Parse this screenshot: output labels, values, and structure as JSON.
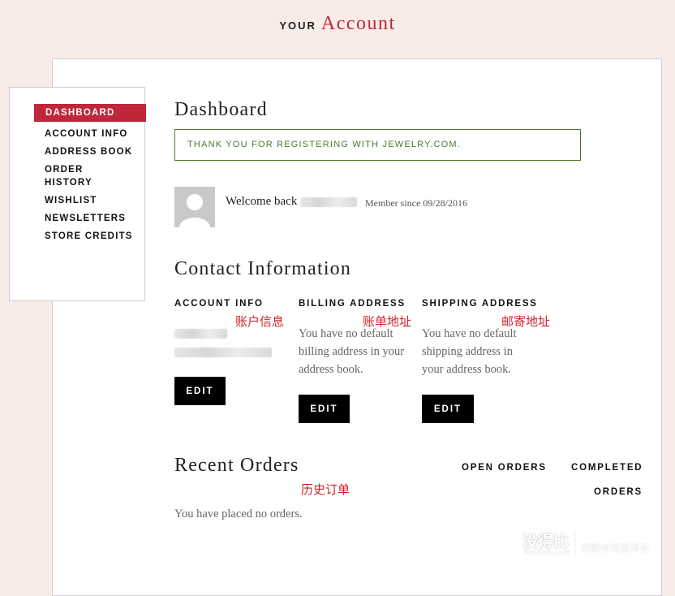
{
  "header": {
    "small": "your",
    "big": "Account"
  },
  "sidebar": {
    "items": [
      {
        "label": "DASHBOARD",
        "active": true
      },
      {
        "label": "ACCOUNT INFO",
        "active": false
      },
      {
        "label": "ADDRESS BOOK",
        "active": false
      },
      {
        "label": "ORDER HISTORY",
        "active": false
      },
      {
        "label": "WISHLIST",
        "active": false
      },
      {
        "label": "NEWSLETTERS",
        "active": false
      },
      {
        "label": "STORE CREDITS",
        "active": false
      }
    ]
  },
  "dashboard": {
    "title": "Dashboard",
    "notice": "THANK YOU FOR REGISTERING WITH JEWELRY.COM.",
    "welcome": "Welcome back",
    "member_since": "Member since 09/28/2016"
  },
  "contact": {
    "title": "Contact Information",
    "account_info": {
      "label": "ACCOUNT INFO",
      "note": "账户信息",
      "edit": "EDIT"
    },
    "billing": {
      "label": "BILLING ADDRESS",
      "note": "账单地址",
      "text": "You have no default billing address in your address book.",
      "edit": "EDIT"
    },
    "shipping": {
      "label": "SHIPPING ADDRESS",
      "note": "邮寄地址",
      "text": "You have no default shipping address in your address book.",
      "edit": "EDIT"
    }
  },
  "orders": {
    "title": "Recent Orders",
    "note": "历史订单",
    "tab_open": "OPEN ORDERS",
    "tab_completed_1": "COMPLETED",
    "tab_completed_2": "ORDERS",
    "empty_text": "You have placed no orders."
  },
  "watermark": {
    "cn": "没得比",
    "url": "Meidebi.com",
    "slogan": "网购有钱就得花"
  },
  "colors": {
    "accent": "#c0273a",
    "notice_green": "#4a7a2c",
    "background": "#f8ece8",
    "annotation_red": "#d2232a"
  }
}
